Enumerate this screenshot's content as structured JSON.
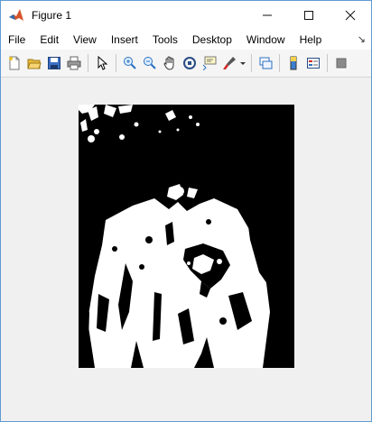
{
  "window": {
    "title": "Figure 1",
    "icon": "matlab-logo-icon",
    "controls": {
      "minimize": "—",
      "maximize": "☐",
      "close": "✕"
    }
  },
  "menu": {
    "items": [
      {
        "label": "File"
      },
      {
        "label": "Edit"
      },
      {
        "label": "View"
      },
      {
        "label": "Insert"
      },
      {
        "label": "Tools"
      },
      {
        "label": "Desktop"
      },
      {
        "label": "Window"
      },
      {
        "label": "Help"
      }
    ],
    "dock_arrow": "↘"
  },
  "toolbar": {
    "buttons": [
      "new-figure-icon",
      "open-file-icon",
      "save-icon",
      "print-icon",
      "edit-plot-icon",
      "zoom-in-icon",
      "zoom-out-icon",
      "pan-icon",
      "rotate-3d-icon",
      "data-cursor-icon",
      "brush-icon",
      "link-plot-icon",
      "colorbar-icon",
      "legend-icon",
      "property-editor-icon"
    ]
  },
  "figure": {
    "image": "binary-image-person",
    "background": "#000000",
    "foreground": "#ffffff"
  }
}
